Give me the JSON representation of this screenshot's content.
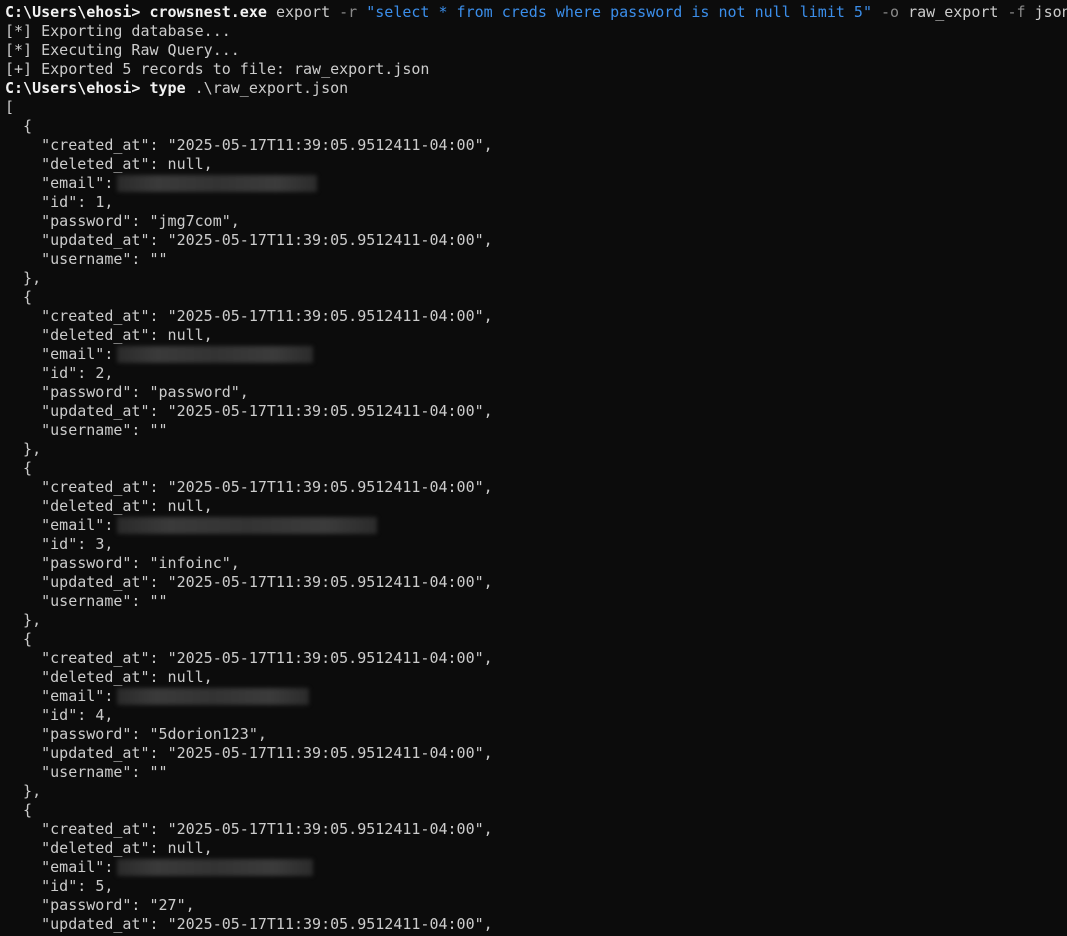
{
  "prompt": "C:\\Users\\ehosi>",
  "command1": {
    "exe": "crowsnest.exe",
    "subcommand": "export",
    "flag_r": "-r",
    "query": "\"select * from creds where password is not null limit 5\"",
    "flag_o": "-o",
    "output_name": "raw_export",
    "flag_f": "-f",
    "format": "json"
  },
  "output_lines": [
    "[*] Exporting database...",
    "[*] Executing Raw Query...",
    "[+] Exported 5 records to file: raw_export.json"
  ],
  "command2": {
    "exe": "type",
    "arg": ".\\raw_export.json"
  },
  "json_open": "[",
  "record_open": "  {",
  "record_close": "  },",
  "labels": {
    "created_at": "    \"created_at\": ",
    "deleted_at": "    \"deleted_at\": null,",
    "email": "    \"email\":",
    "id": "    \"id\": ",
    "password": "    \"password\": ",
    "updated_at": "    \"updated_at\": ",
    "username": "    \"username\": \"\""
  },
  "records": [
    {
      "created_at": "\"2025-05-17T11:39:05.9512411-04:00\",",
      "id": "1,",
      "password": "\"jmg7com\",",
      "updated_at": "\"2025-05-17T11:39:05.9512411-04:00\","
    },
    {
      "created_at": "\"2025-05-17T11:39:05.9512411-04:00\",",
      "id": "2,",
      "password": "\"password\",",
      "updated_at": "\"2025-05-17T11:39:05.9512411-04:00\","
    },
    {
      "created_at": "\"2025-05-17T11:39:05.9512411-04:00\",",
      "id": "3,",
      "password": "\"infoinc\",",
      "updated_at": "\"2025-05-17T11:39:05.9512411-04:00\","
    },
    {
      "created_at": "\"2025-05-17T11:39:05.9512411-04:00\",",
      "id": "4,",
      "password": "\"5dorion123\",",
      "updated_at": "\"2025-05-17T11:39:05.9512411-04:00\","
    },
    {
      "created_at": "\"2025-05-17T11:39:05.9512411-04:00\",",
      "id": "5,",
      "password": "\"27\",",
      "updated_at": "\"2025-05-17T11:39:05.9512411-04:00\","
    }
  ],
  "colors": {
    "background": "#0c0c0c",
    "text": "#cccccc",
    "string_arg": "#3b8eea",
    "flag": "#8a8a8a"
  }
}
